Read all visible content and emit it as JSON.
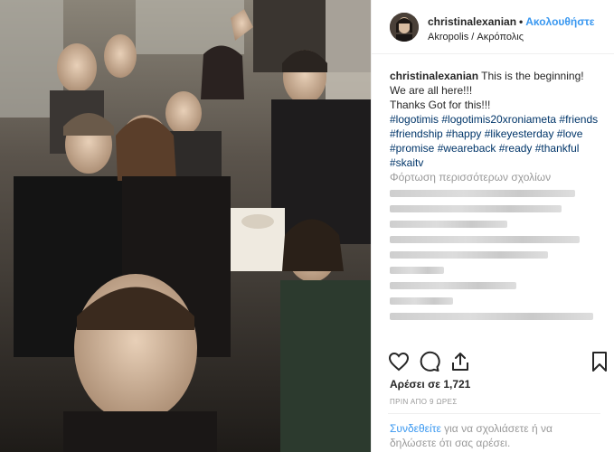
{
  "post": {
    "photo_alt": "Group selfie of friends at a table",
    "header": {
      "username": "christinalexanian",
      "dot": "•",
      "follow_label": "Ακολουθήστε",
      "location": "Akropolis / Ακρόπολις"
    },
    "caption": {
      "username": "christinalexanian",
      "line1": "This is the beginning!",
      "line2": "We are all here!!!",
      "line3": "Thanks Got for this!!!",
      "hashtags": "#logotimis #logotimis20xroniameta #friends #friendship #happy #likeyesterday #love #promise #weareback #ready #thankful #skaitv"
    },
    "load_more": "Φόρτωση περισσότερων σχολίων",
    "comments_count_visible": 10,
    "actions": {
      "like_icon": "heart-icon",
      "comment_icon": "comment-icon",
      "share_icon": "share-icon",
      "save_icon": "bookmark-icon"
    },
    "likes": "Αρέσει σε 1,721",
    "timestamp": "ΠΡΙΝ ΑΠΟ 9 ΩΡΕΣ",
    "login_prompt": {
      "link": "Συνδεθείτε",
      "rest": "για να σχολιάσετε ή να δηλώσετε ότι σας αρέσει."
    },
    "colors": {
      "link_blue": "#3897f0",
      "hashtag_blue": "#003569",
      "muted": "#999999",
      "text": "#262626"
    }
  }
}
